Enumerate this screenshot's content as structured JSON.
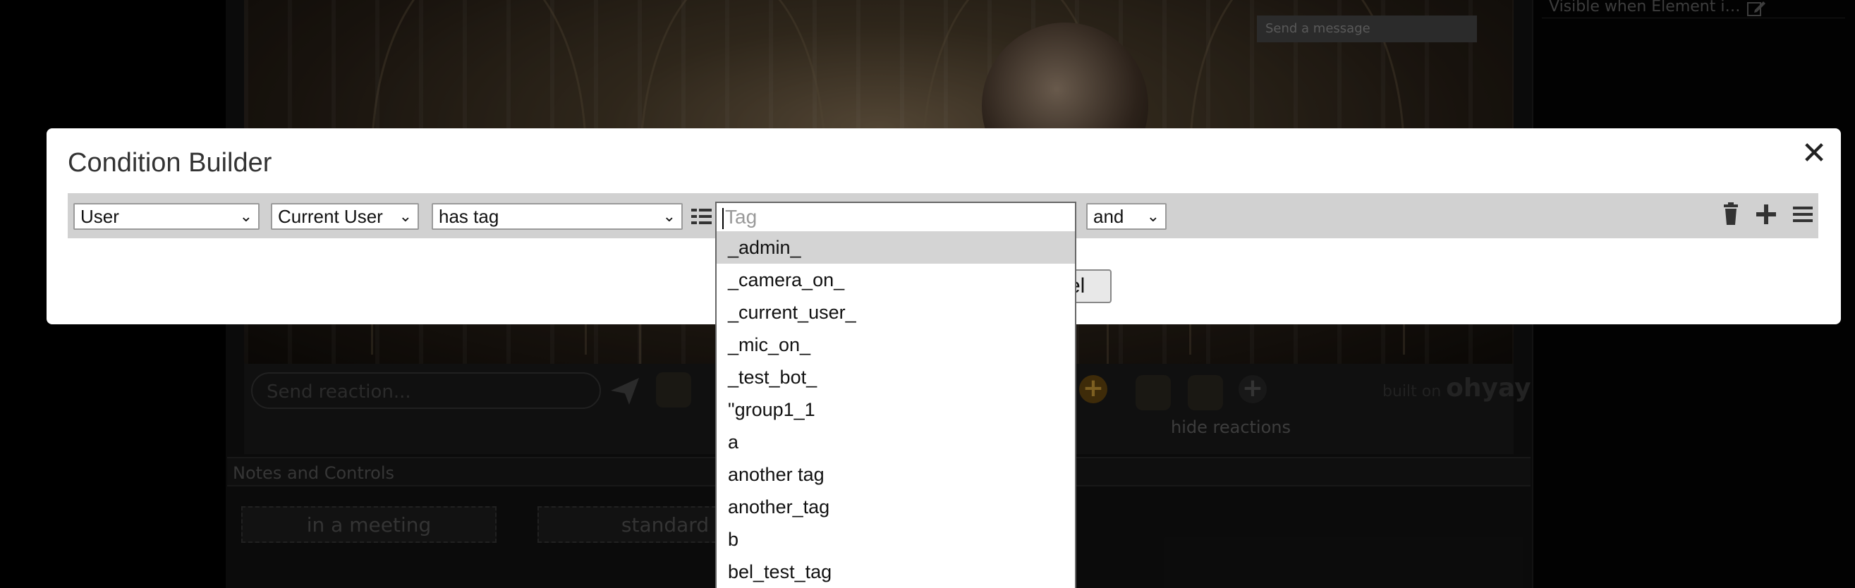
{
  "background": {
    "right_panel_item": "Visible when Element i…",
    "chat_placeholder": "Send a message",
    "reaction_placeholder": "Send reaction...",
    "hide_reactions": "hide reactions",
    "built_on": "built on",
    "brand": "ohyay",
    "notes_header": "Notes and Controls",
    "meeting_buttons": [
      "in a meeting",
      "standard"
    ]
  },
  "modal": {
    "title": "Condition Builder",
    "close_label": "✕",
    "cancel_label": "cel",
    "row": {
      "subject_select": "User",
      "target_select": "Current User",
      "operator_select": "has tag",
      "tag_placeholder": "Tag",
      "logic_select": "and"
    },
    "dropdown_options": [
      "_admin_",
      "_camera_on_",
      "_current_user_",
      "_mic_on_",
      "_test_bot_",
      "\"group1_1",
      "a",
      "another tag",
      "another_tag",
      "b",
      "bel_test_tag"
    ],
    "highlighted_option": "_admin_"
  },
  "icons": {
    "list": "list-icon",
    "delete": "trash-icon",
    "add": "plus-icon",
    "menu": "hamburger-icon",
    "close": "close-icon",
    "send": "send-icon",
    "edit": "edit-icon"
  }
}
